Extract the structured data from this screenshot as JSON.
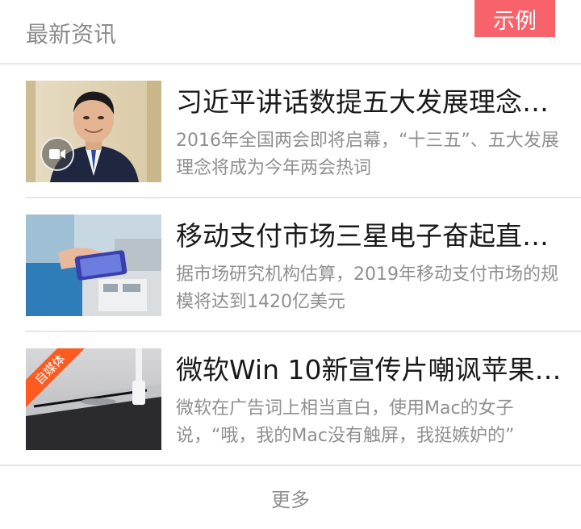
{
  "header": {
    "title": "最新资讯",
    "badge": "示例"
  },
  "news": [
    {
      "title": "习近平讲话数提五大发展理念…",
      "summary": "2016年全国两会即将启幕，“十三五”、五大发展理念将成为今年两会热词",
      "thumb_icon": "video-camera-icon"
    },
    {
      "title": "移动支付市场三星电子奋起直…",
      "summary": "据市场研究机构估算，2019年移动支付市场的规模将达到1420亿美元"
    },
    {
      "title": "微软Win 10新宣传片嘲讽苹果…",
      "summary": "微软在广告词上相当直白，使用Mac的女子说，“哦，我的Mac没有触屏，我挺嫉妒的”",
      "ribbon": "自媒体"
    }
  ],
  "footer": {
    "more_label": "更多"
  },
  "colors": {
    "accent": "#f7626b",
    "ribbon": "#ff5a1f",
    "title_text": "#1a1a1a",
    "muted_text": "#8f8f8f",
    "divider": "#e6e6e6"
  }
}
